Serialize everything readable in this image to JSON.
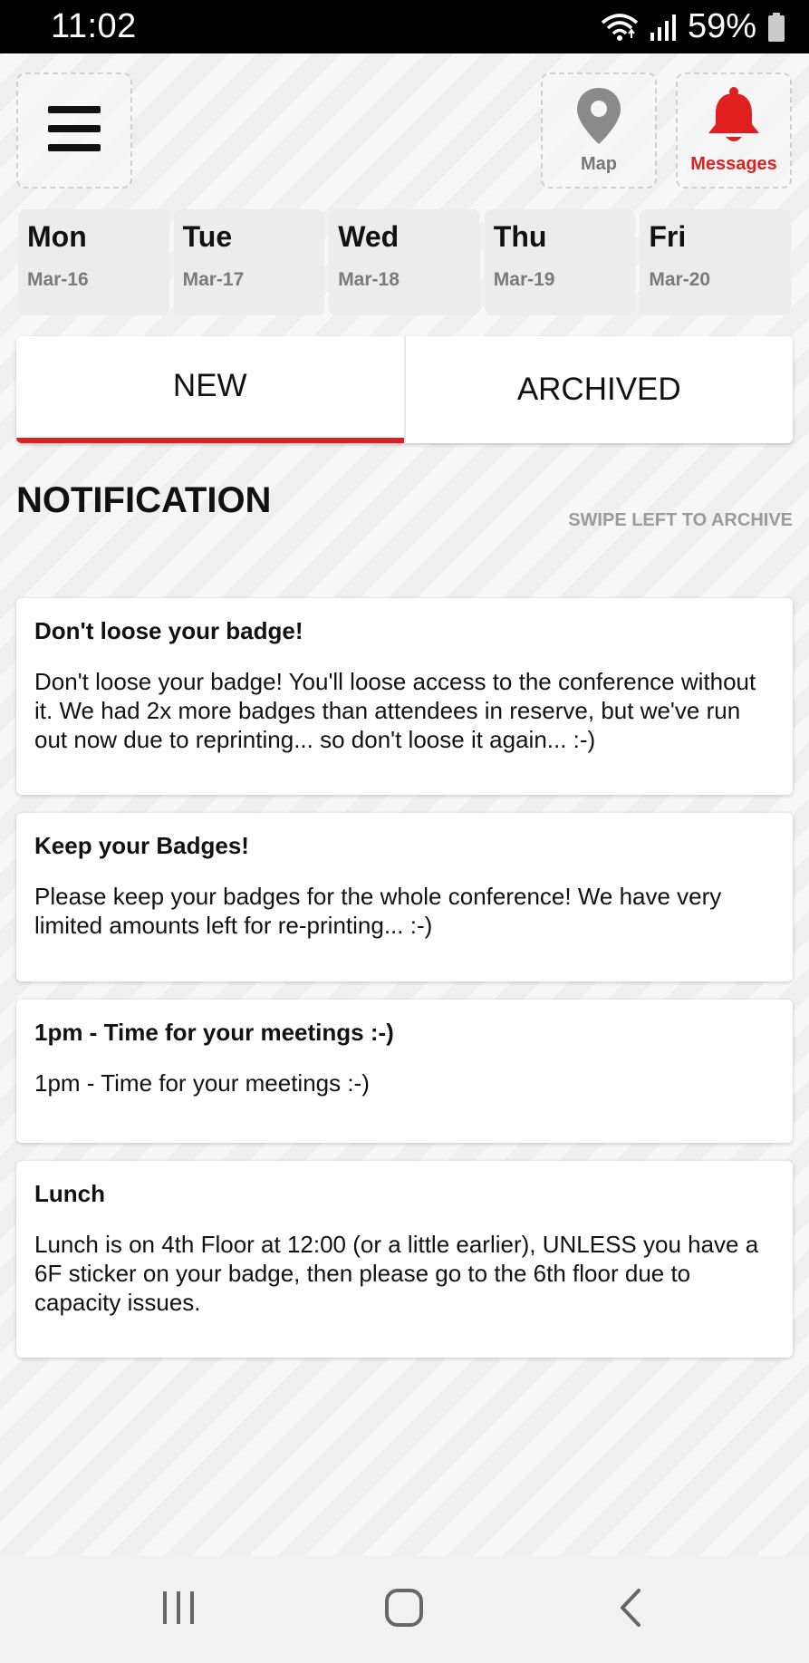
{
  "status_bar": {
    "time": "11:02",
    "battery": "59%",
    "icons": [
      "wifi-icon",
      "signal-icon",
      "battery-icon"
    ]
  },
  "header": {
    "menu_icon": "hamburger-menu-icon",
    "map": {
      "label": "Map",
      "icon": "map-pin-icon"
    },
    "messages": {
      "label": "Messages",
      "icon": "bell-icon"
    }
  },
  "days": [
    {
      "name": "Mon",
      "date": "Mar-16"
    },
    {
      "name": "Tue",
      "date": "Mar-17"
    },
    {
      "name": "Wed",
      "date": "Mar-18"
    },
    {
      "name": "Thu",
      "date": "Mar-19"
    },
    {
      "name": "Fri",
      "date": "Mar-20"
    }
  ],
  "tabs": [
    {
      "label": "NEW",
      "active": true
    },
    {
      "label": "ARCHIVED",
      "active": false
    }
  ],
  "section": {
    "title": "NOTIFICATION",
    "hint": "SWIPE LEFT TO ARCHIVE"
  },
  "notifications": [
    {
      "title": "Don't loose your badge!",
      "body": "Don't loose your badge! You'll loose access to the conference without it. We had 2x more badges than attendees in reserve, but we've run out now due to reprinting... so don't loose it again... :-)"
    },
    {
      "title": "Keep your Badges!",
      "body": "Please keep your badges for the whole conference! We have very limited amounts left for re-printing... :-)"
    },
    {
      "title": "1pm - Time for your meetings :-)",
      "body": "1pm - Time for your meetings :-)"
    },
    {
      "title": "Lunch",
      "body": "Lunch is on 4th Floor at 12:00 (or a little earlier), UNLESS you have a 6F sticker on your badge, then please go to the 6th floor due to capacity issues."
    }
  ],
  "nav_bar": {
    "icons": [
      "recent-apps-icon",
      "home-icon",
      "back-icon"
    ]
  },
  "colors": {
    "accent": "#e01f1f",
    "muted": "#777777",
    "card_bg": "#ffffff",
    "day_bg": "#ececec"
  }
}
